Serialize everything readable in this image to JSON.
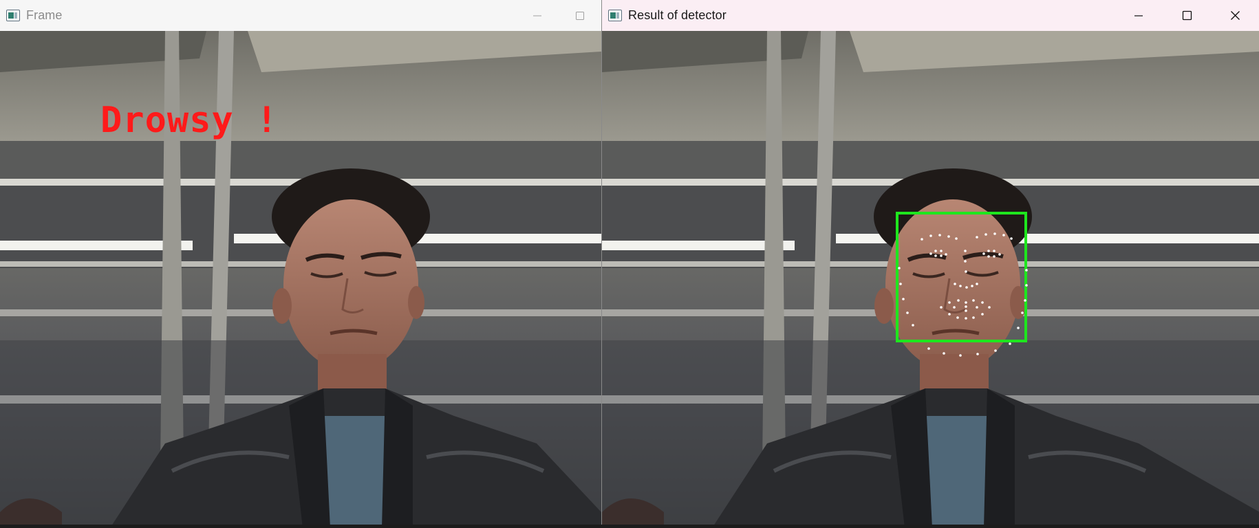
{
  "windows": {
    "frame": {
      "title": "Frame",
      "minimize": "—",
      "maximize": "☐"
    },
    "detector": {
      "title": "Result of detector",
      "minimize": "—",
      "maximize": "☐",
      "close": "✕"
    }
  },
  "overlay": {
    "alert_text": "Drowsy !",
    "alert_color": "#ff1a1a"
  },
  "detection": {
    "box_color": "#1ee61e",
    "landmark_color": "#ffffff"
  }
}
